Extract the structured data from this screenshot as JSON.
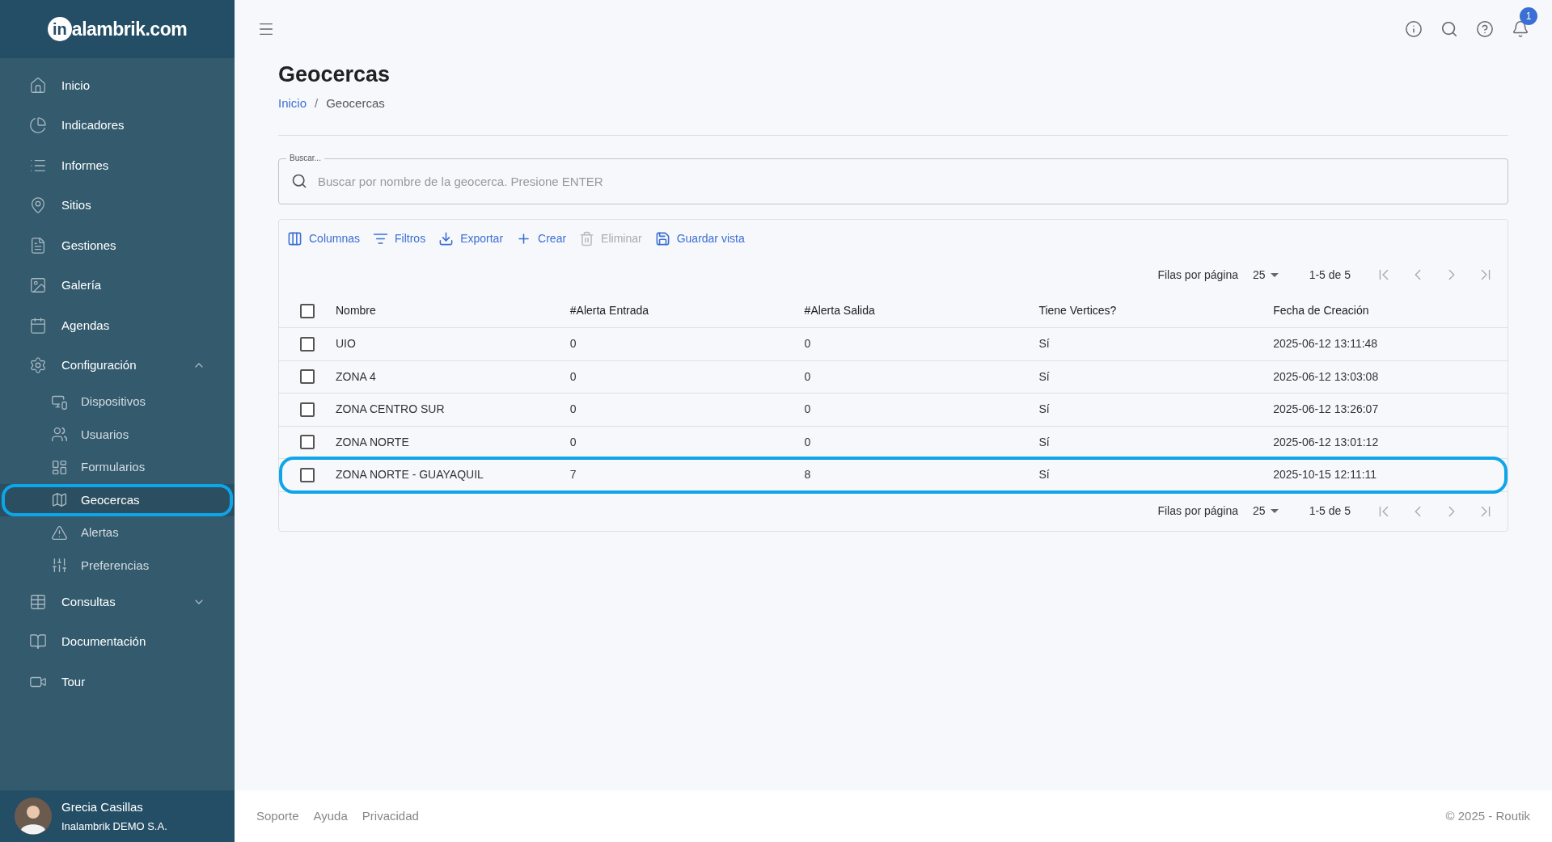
{
  "logo": {
    "mark": "in",
    "text": "alambrik.com"
  },
  "sidebar": {
    "items": [
      {
        "label": "Inicio",
        "selected": false
      },
      {
        "label": "Indicadores",
        "selected": false
      },
      {
        "label": "Informes",
        "selected": false
      },
      {
        "label": "Sitios",
        "selected": false
      },
      {
        "label": "Gestiones",
        "selected": false
      },
      {
        "label": "Galería",
        "selected": false
      },
      {
        "label": "Agendas",
        "selected": false
      },
      {
        "label": "Configuración",
        "selected": false,
        "expanded": true,
        "children": [
          {
            "label": "Dispositivos",
            "selected": false,
            "highlighted": false
          },
          {
            "label": "Usuarios",
            "selected": false,
            "highlighted": false
          },
          {
            "label": "Formularios",
            "selected": false,
            "highlighted": false
          },
          {
            "label": "Geocercas",
            "selected": true,
            "highlighted": true
          },
          {
            "label": "Alertas",
            "selected": false,
            "highlighted": false
          },
          {
            "label": "Preferencias",
            "selected": false,
            "highlighted": false
          }
        ]
      },
      {
        "label": "Consultas",
        "selected": false,
        "expanded": false
      },
      {
        "label": "Documentación",
        "selected": false
      },
      {
        "label": "Tour",
        "selected": false
      }
    ],
    "user": {
      "name": "Grecia Casillas",
      "company": "Inalambrik DEMO S.A."
    }
  },
  "header": {
    "notification_count": "1"
  },
  "page": {
    "title": "Geocercas",
    "breadcrumb": [
      "Inicio",
      "Geocercas"
    ],
    "breadcrumb_separator": "/"
  },
  "search": {
    "label": "Buscar...",
    "placeholder": "Buscar por nombre de la geocerca. Presione ENTER"
  },
  "toolbar": [
    {
      "label": "Columnas",
      "disabled": false
    },
    {
      "label": "Filtros",
      "disabled": false
    },
    {
      "label": "Exportar",
      "disabled": false
    },
    {
      "label": "Crear",
      "disabled": false
    },
    {
      "label": "Eliminar",
      "disabled": true
    },
    {
      "label": "Guardar vista",
      "disabled": false
    }
  ],
  "pagination": [
    {
      "rows_label": "Filas por página",
      "rows_per_page": "25",
      "range": "1-5 de 5"
    },
    {
      "rows_label": "Filas por página",
      "rows_per_page": "25",
      "range": "1-5 de 5"
    }
  ],
  "table": {
    "columns": [
      "Nombre",
      "#Alerta Entrada",
      "#Alerta Salida",
      "Tiene Vertices?",
      "Fecha de Creación"
    ],
    "all_checked": false,
    "rows": [
      {
        "cells": [
          "UIO",
          "0",
          "0",
          "Sí",
          "2025-06-12 13:11:48"
        ],
        "checked": false,
        "highlighted": false
      },
      {
        "cells": [
          "ZONA 4",
          "0",
          "0",
          "Sí",
          "2025-06-12 13:03:08"
        ],
        "checked": false,
        "highlighted": false
      },
      {
        "cells": [
          "ZONA CENTRO SUR",
          "0",
          "0",
          "Sí",
          "2025-06-12 13:26:07"
        ],
        "checked": false,
        "highlighted": false
      },
      {
        "cells": [
          "ZONA NORTE",
          "0",
          "0",
          "Sí",
          "2025-06-12 13:01:12"
        ],
        "checked": false,
        "highlighted": false
      },
      {
        "cells": [
          "ZONA NORTE - GUAYAQUIL",
          "7",
          "8",
          "Sí",
          "2025-10-15 12:11:11"
        ],
        "checked": false,
        "highlighted": true
      }
    ]
  },
  "footer": {
    "links": [
      "Soporte",
      "Ayuda",
      "Privacidad"
    ],
    "copyright": "© 2025 - Routik"
  }
}
